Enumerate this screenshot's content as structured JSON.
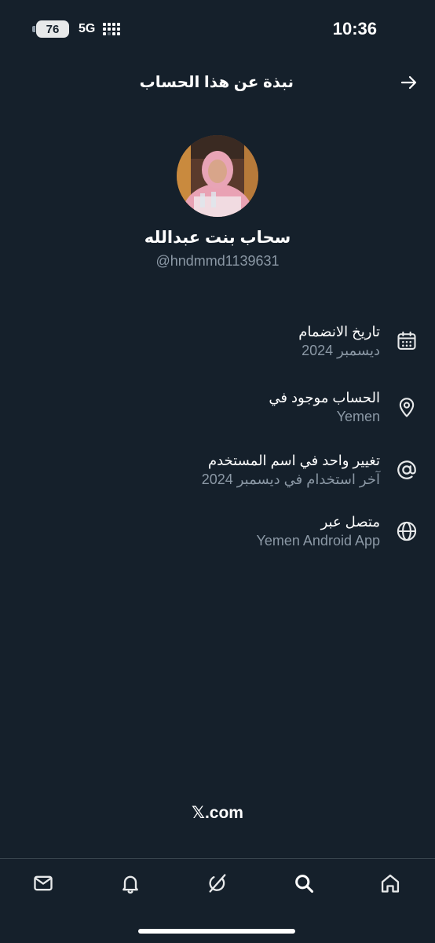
{
  "status_bar": {
    "battery": "76",
    "network": "5G",
    "time": "10:36"
  },
  "header": {
    "title": "نبذة عن هذا الحساب"
  },
  "profile": {
    "display_name": "سحاب بنت عبدالله",
    "handle": "@hndmmd1139631"
  },
  "info": [
    {
      "icon": "calendar-icon",
      "title": "تاريخ الانضمام",
      "subtitle": "ديسمبر 2024"
    },
    {
      "icon": "location-pin-icon",
      "title": "الحساب موجود في",
      "subtitle": "Yemen"
    },
    {
      "icon": "at-sign-icon",
      "title": "تغيير واحد في اسم المستخدم",
      "subtitle": "آخر استخدام في ديسمبر 2024"
    },
    {
      "icon": "globe-icon",
      "title": "متصل عبر",
      "subtitle": "Yemen Android App"
    }
  ],
  "footer": {
    "brand_mark": "𝕏",
    "brand_text": ".com"
  },
  "tabs": [
    "mail-icon",
    "bell-icon",
    "grok-icon",
    "search-icon",
    "home-icon"
  ],
  "colors": {
    "background": "#15202b",
    "text_primary": "#ffffff",
    "text_secondary": "#8b98a5",
    "divider": "#38444d"
  }
}
